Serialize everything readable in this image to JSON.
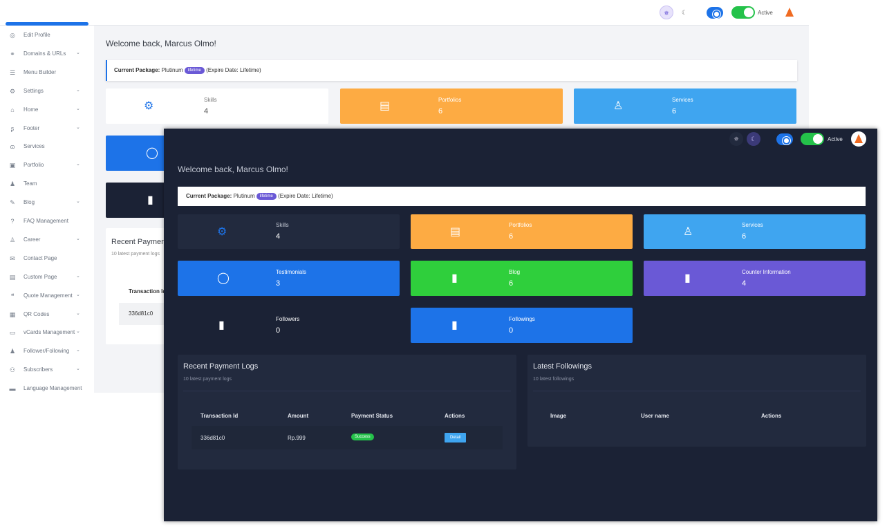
{
  "light": {
    "sidebar": {
      "items": [
        {
          "label": "Edit Profile",
          "icon": "user-circle-icon",
          "glyph": "◎",
          "chevron": false
        },
        {
          "label": "Domains & URLs",
          "icon": "link-icon",
          "glyph": "⚭",
          "chevron": true
        },
        {
          "label": "Menu Builder",
          "icon": "menu-icon",
          "glyph": "☰",
          "chevron": false
        },
        {
          "label": "Settings",
          "icon": "gear-icon",
          "glyph": "⚙",
          "chevron": true
        },
        {
          "label": "Home",
          "icon": "home-icon",
          "glyph": "⌂",
          "chevron": true
        },
        {
          "label": "Footer",
          "icon": "footer-icon",
          "glyph": "ʂ",
          "chevron": true
        },
        {
          "label": "Services",
          "icon": "hands-icon",
          "glyph": "ɷ",
          "chevron": false
        },
        {
          "label": "Portfolio",
          "icon": "briefcase-icon",
          "glyph": "▣",
          "chevron": true
        },
        {
          "label": "Team",
          "icon": "team-icon",
          "glyph": "♟",
          "chevron": false
        },
        {
          "label": "Blog",
          "icon": "blog-icon",
          "glyph": "✎",
          "chevron": true
        },
        {
          "label": "FAQ Management",
          "icon": "question-icon",
          "glyph": "?",
          "chevron": false
        },
        {
          "label": "Career",
          "icon": "career-icon",
          "glyph": "♙",
          "chevron": true
        },
        {
          "label": "Contact Page",
          "icon": "envelope-icon",
          "glyph": "✉",
          "chevron": false
        },
        {
          "label": "Custom Page",
          "icon": "page-icon",
          "glyph": "▤",
          "chevron": true
        },
        {
          "label": "Quote Management",
          "icon": "quote-icon",
          "glyph": "❝",
          "chevron": true
        },
        {
          "label": "QR Codes",
          "icon": "qr-icon",
          "glyph": "▦",
          "chevron": true
        },
        {
          "label": "vCards Management",
          "icon": "vcard-icon",
          "glyph": "▭",
          "chevron": true
        },
        {
          "label": "Follower/Following",
          "icon": "users-icon",
          "glyph": "♟",
          "chevron": true
        },
        {
          "label": "Subscribers",
          "icon": "subscribers-icon",
          "glyph": "⚇",
          "chevron": true
        },
        {
          "label": "Language Management",
          "icon": "language-icon",
          "glyph": "▬",
          "chevron": false
        }
      ],
      "chevron_glyph": "⌄"
    },
    "header": {
      "status_label": "Active"
    },
    "welcome": "Welcome back, Marcus Olmo!",
    "package": {
      "label": "Current Package:",
      "name": "Plutinum",
      "badge": "lifetime",
      "expire": "(Expire Date: Lifetime)"
    },
    "cards": [
      {
        "title": "Skills",
        "value": "4"
      },
      {
        "title": "Portfolios",
        "value": "6"
      },
      {
        "title": "Services",
        "value": "6"
      }
    ],
    "payment": {
      "title": "Recent Payment",
      "subtitle": "10 latest payment logs",
      "col": "Transaction Id",
      "row": "336d81c0"
    }
  },
  "dark": {
    "header": {
      "status_label": "Active"
    },
    "welcome": "Welcome back, Marcus Olmo!",
    "package": {
      "label": "Current Package:",
      "name": "Plutinum",
      "badge": "lifetime",
      "expire": "(Expire Date: Lifetime)"
    },
    "cards": [
      {
        "title": "Skills",
        "value": "4",
        "icon": "gears-icon"
      },
      {
        "title": "Portfolios",
        "value": "6",
        "icon": "id-card-icon"
      },
      {
        "title": "Services",
        "value": "6",
        "icon": "user-shield-icon"
      },
      {
        "title": "Testimonials",
        "value": "3",
        "icon": "comment-icon"
      },
      {
        "title": "Blog",
        "value": "6",
        "icon": "file-icon"
      },
      {
        "title": "Counter Information",
        "value": "4",
        "icon": "book-icon"
      },
      {
        "title": "Followers",
        "value": "0",
        "icon": "book-icon"
      },
      {
        "title": "Followings",
        "value": "0",
        "icon": "book-icon"
      }
    ],
    "payment_logs": {
      "title": "Recent Payment Logs",
      "subtitle": "10 latest payment logs",
      "columns": [
        "Transaction Id",
        "Amount",
        "Payment Status",
        "Actions"
      ],
      "rows": [
        {
          "id": "336d81c0",
          "amount": "Rp.999",
          "status": "Success",
          "action": "Detail"
        }
      ]
    },
    "followings": {
      "title": "Latest Followings",
      "subtitle": "10 latest followings",
      "columns": [
        "Image",
        "User name",
        "Actions"
      ]
    }
  },
  "colors": {
    "primary_blue": "#1d73e8",
    "orange": "#fdab43",
    "sky": "#3fa5f0",
    "green": "#2fcf3c",
    "purple": "#6a59d6",
    "dark_bg": "#1b2235",
    "dark_card": "#222a3e",
    "toggle_green": "#24c24a",
    "avatar_orange": "#f06b22"
  }
}
